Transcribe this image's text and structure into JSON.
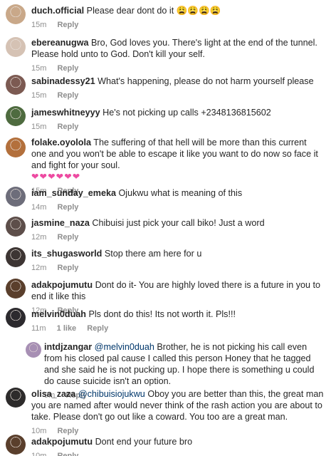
{
  "reply_label": "Reply",
  "comments": [
    {
      "user": "duch.official",
      "text": "Please dear dont do it",
      "emoji": "😩😩😩😩",
      "time": "15m"
    },
    {
      "user": "ebereanugwa",
      "text": "Bro, God loves you. There's light at the end of the tunnel. Please hold unto to God. Don't kill your self.",
      "time": "15m"
    },
    {
      "user": "sabinadessy21",
      "text": "What's happening, please do not harm yourself please",
      "time": "15m"
    },
    {
      "user": "jameswhitneyyy",
      "text": "He's not picking up calls +2348136815602",
      "time": "15m"
    },
    {
      "user": "folake.oyolola",
      "text": "The suffering of that hell will be more than this current one and you won't be able to escape it like you want to do now so face it and fight for your soul.",
      "hearts": "❤❤❤❤❤❤",
      "time": "15m"
    },
    {
      "user": "iam_sunday_emeka",
      "text": "Ojukwu what is meaning of this",
      "time": "14m"
    },
    {
      "user": "jasmine_naza",
      "text": "Chibuisi just pick your call biko! Just a word",
      "time": "12m"
    },
    {
      "user": "its_shugasworld",
      "text": "Stop there am here for u",
      "time": "12m"
    },
    {
      "user": "adakpojumutu",
      "text": "Dont do it- You are highly loved there is a future in you to end it like this",
      "time": "12m"
    },
    {
      "user": "melvin0duah",
      "text": "Pls dont do this! Its not worth it. Pls!!!",
      "time": "11m",
      "likes": "1 like"
    },
    {
      "user": "intdjzangar",
      "mention": "@melvin0duah",
      "text": "Brother, he is not picking his call even from his closed pal cause I called this person Honey that he tagged and she said he is not pucking up. I hope there is something u could do cause suicide isn't an option.",
      "time": "9m"
    },
    {
      "user": "olisa_zaza",
      "mention": "@chibuisiojukwu",
      "text": "Oboy you are better than this, the great man you are named after would never think of the rash action you are about to take. Please don't go out like a coward. You too are a great man.",
      "time": "10m"
    },
    {
      "user": "adakpojumutu",
      "text": "Dont end your future bro",
      "time": "10m"
    }
  ],
  "avatar_colors": [
    "#c9a889",
    "#d5c2b4",
    "#7c5a52",
    "#4e6b3f",
    "#b3703c",
    "#6d6d7a",
    "#5d4e4a",
    "#3d3533",
    "#5a3f2c",
    "#2c2a2e",
    "#a78fb4",
    "#2d2b2b",
    "#5a3f2c"
  ]
}
